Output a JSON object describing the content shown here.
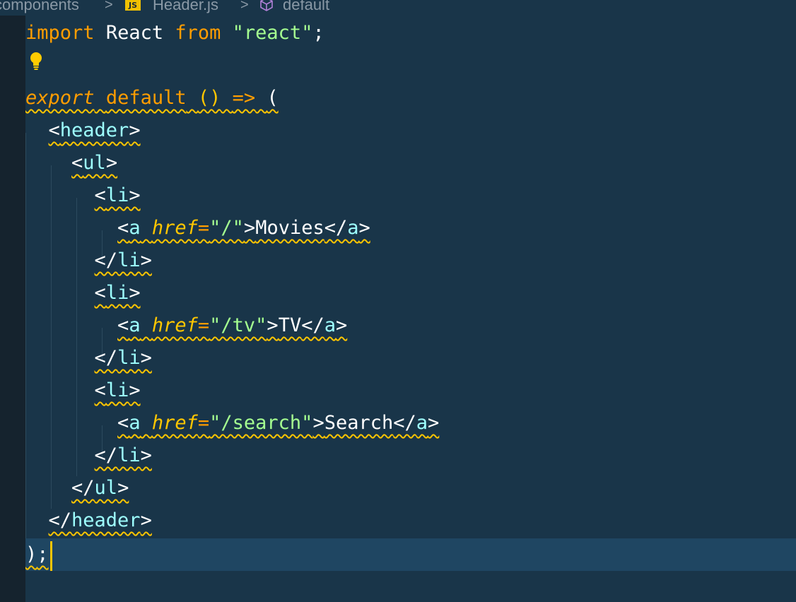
{
  "breadcrumb": {
    "folder": "components",
    "file_badge": "JS",
    "file": "Header.js",
    "symbol": "default",
    "separator": ">"
  },
  "code": {
    "line1": {
      "kw_import": "import",
      "ident": "React",
      "kw_from": "from",
      "string": "\"react\"",
      "semi": ";"
    },
    "line3": {
      "kw_export": "export",
      "kw_default": "default",
      "parens": "()",
      "arrow": "=>",
      "open_paren": "("
    },
    "line4": {
      "open": "<",
      "tag": "header",
      "close": ">"
    },
    "line5": {
      "open": "<",
      "tag": "ul",
      "close": ">"
    },
    "line6": {
      "open": "<",
      "tag": "li",
      "close": ">"
    },
    "line7": {
      "open": "<",
      "tag": "a",
      "attr": "href",
      "eq": "=",
      "value": "\"/\"",
      "gt": ">",
      "text": "Movies",
      "close_open": "</",
      "close_tag": "a",
      "close_gt": ">"
    },
    "line8": {
      "open": "</",
      "tag": "li",
      "close": ">"
    },
    "line9": {
      "open": "<",
      "tag": "li",
      "close": ">"
    },
    "line10": {
      "open": "<",
      "tag": "a",
      "attr": "href",
      "eq": "=",
      "value": "\"/tv\"",
      "gt": ">",
      "text": "TV",
      "close_open": "</",
      "close_tag": "a",
      "close_gt": ">"
    },
    "line11": {
      "open": "</",
      "tag": "li",
      "close": ">"
    },
    "line12": {
      "open": "<",
      "tag": "li",
      "close": ">"
    },
    "line13": {
      "open": "<",
      "tag": "a",
      "attr": "href",
      "eq": "=",
      "value": "\"/search\"",
      "gt": ">",
      "text": "Search",
      "close_open": "</",
      "close_tag": "a",
      "close_gt": ">"
    },
    "line14": {
      "open": "</",
      "tag": "li",
      "close": ">"
    },
    "line15": {
      "open": "</",
      "tag": "ul",
      "close": ">"
    },
    "line16": {
      "open": "</",
      "tag": "header",
      "close": ">"
    },
    "line17": {
      "close_paren": ")",
      "semi": ";"
    }
  },
  "icons": {
    "lightbulb": "lightbulb-icon",
    "cube": "symbol-cube-icon"
  },
  "colors": {
    "background": "#193549",
    "keyword": "#ff9d00",
    "string": "#a5ff90",
    "tag": "#9effff",
    "punctuation": "#ffc600",
    "squiggle": "#ffc600",
    "current_line": "#1f4662"
  }
}
